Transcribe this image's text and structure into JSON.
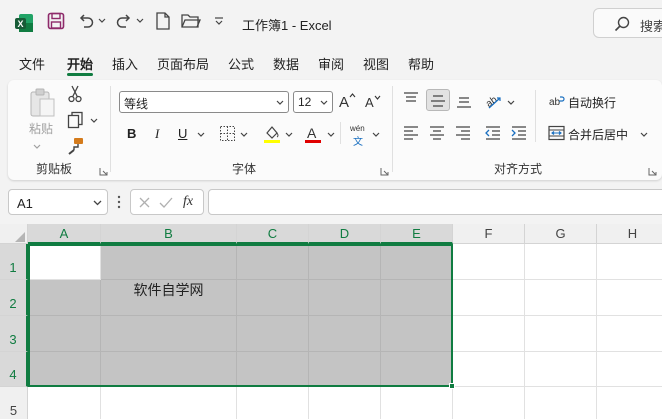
{
  "window": {
    "title": "工作簿1  -  Excel",
    "search_label": "搜索"
  },
  "menu": {
    "tabs": [
      "文件",
      "开始",
      "插入",
      "页面布局",
      "公式",
      "数据",
      "审阅",
      "视图",
      "帮助"
    ],
    "active": "开始"
  },
  "ribbon": {
    "clipboard": {
      "paste_label": "粘贴",
      "group_label": "剪贴板"
    },
    "font": {
      "font_name": "等线",
      "font_size": "12",
      "bold": "B",
      "italic": "I",
      "underline": "U",
      "group_label": "字体",
      "phonetic": "wén",
      "phonetic_char": "文"
    },
    "alignment": {
      "wrap_text": "自动换行",
      "merge_center": "合并后居中",
      "group_label": "对齐方式"
    }
  },
  "formula_bar": {
    "name_box": "A1",
    "fx": "fx",
    "content": ""
  },
  "grid": {
    "columns": [
      "A",
      "B",
      "C",
      "D",
      "E",
      "F",
      "G",
      "H"
    ],
    "rows": [
      "1",
      "2",
      "3",
      "4",
      "5"
    ],
    "merged_cell_text": "软件自学网",
    "selection": "A1:E4",
    "colors": {
      "accent": "#107c41",
      "shade": "#c4c4c4"
    }
  }
}
